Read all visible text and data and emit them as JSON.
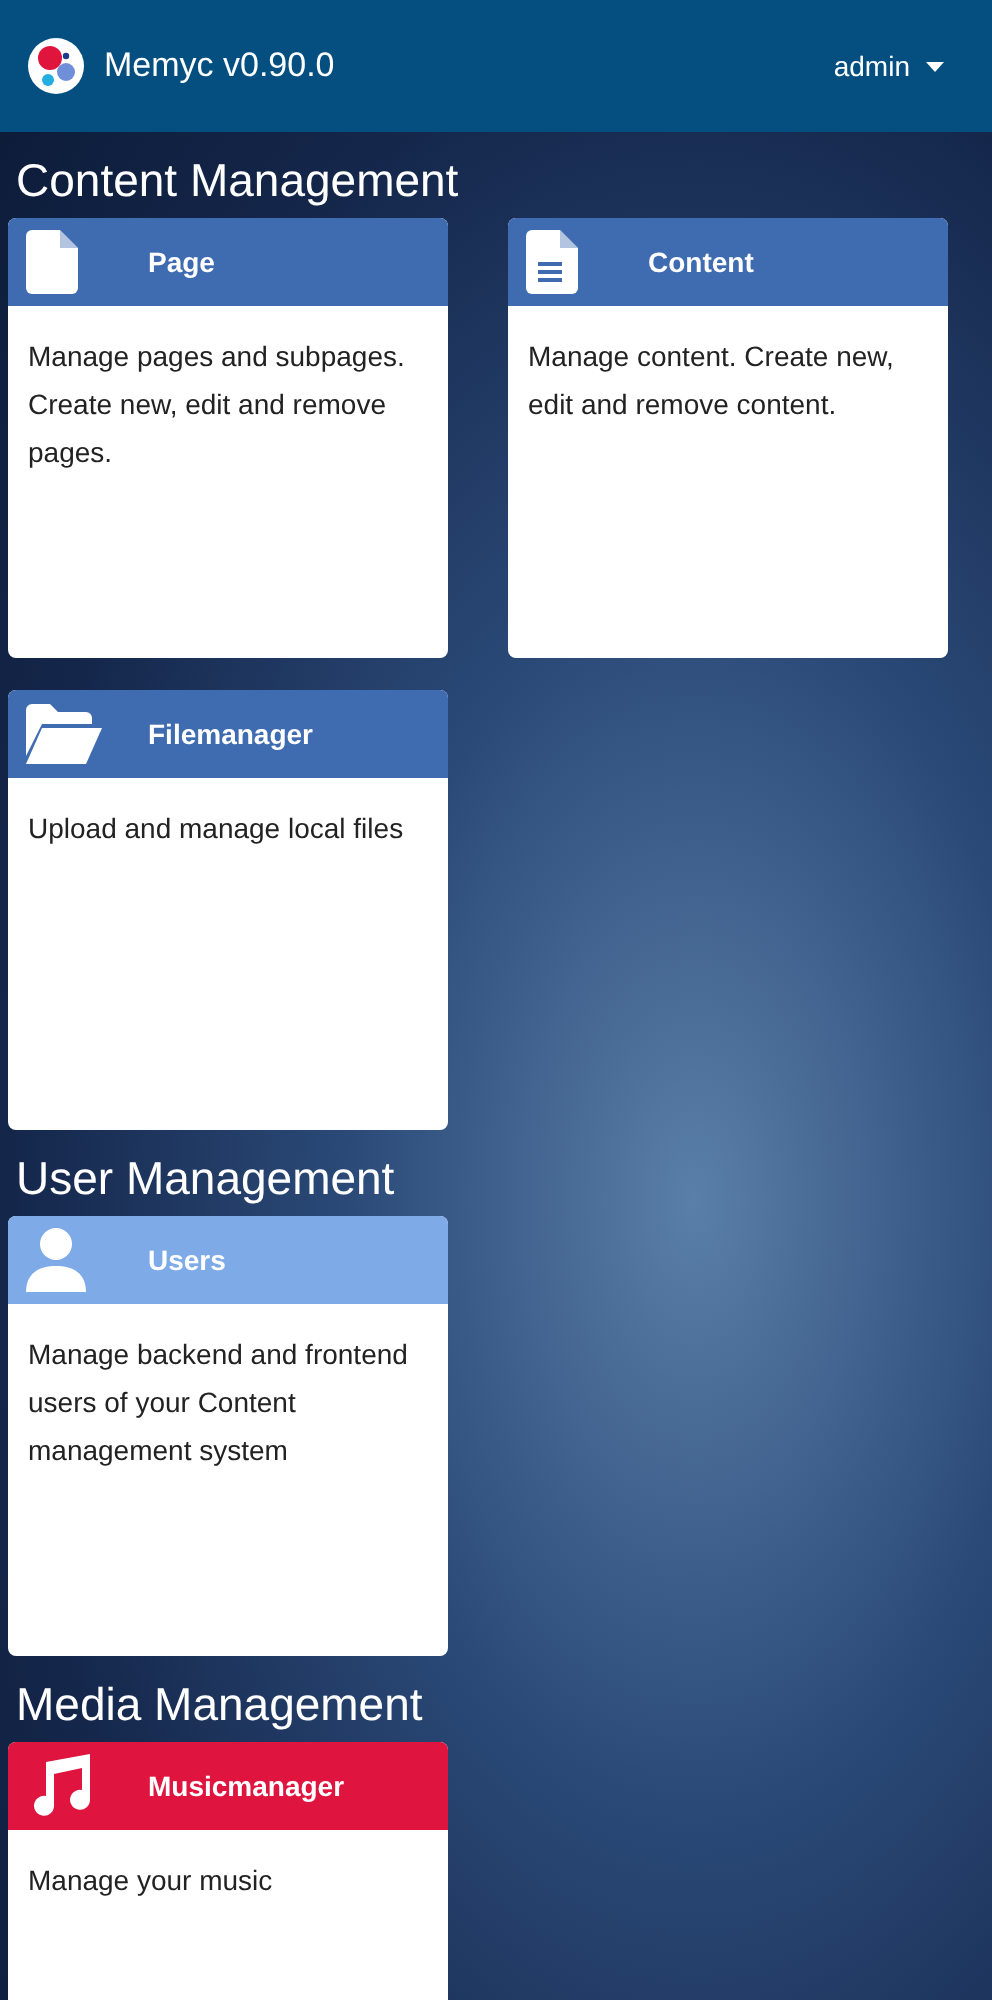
{
  "navbar": {
    "brand": "Memyc v0.90.0",
    "user_menu": "admin"
  },
  "sections": [
    {
      "title": "Content Management",
      "cards": [
        {
          "title": "Page",
          "kind": "file",
          "color": "#3f6bb0",
          "description": "Manage pages and subpages. Create new, edit and remove pages."
        },
        {
          "title": "Content",
          "kind": "document",
          "color": "#3f6bb0",
          "description": "Manage content. Create new, edit and remove content."
        },
        {
          "title": "Filemanager",
          "kind": "folder",
          "color": "#3f6bb0",
          "description": "Upload and manage local files"
        }
      ]
    },
    {
      "title": "User Management",
      "cards": [
        {
          "title": "Users",
          "kind": "user",
          "color": "#7eabe8",
          "description": "Manage backend and frontend users of your Content management system"
        }
      ]
    },
    {
      "title": "Media Management",
      "cards": [
        {
          "title": "Musicmanager",
          "kind": "music",
          "color": "#df1540",
          "description": "Manage your music"
        }
      ]
    }
  ]
}
